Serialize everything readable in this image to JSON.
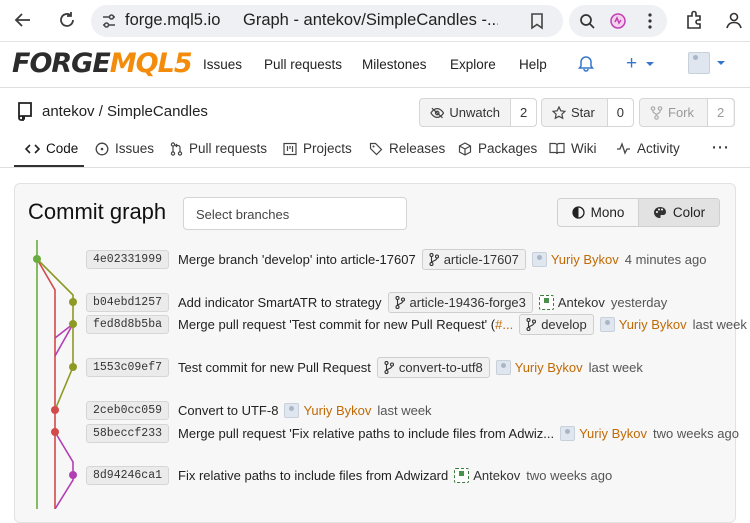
{
  "browser": {
    "host": "forge.mql5.io",
    "tab_title": "Graph - antekov/SimpleCandles -..."
  },
  "brand": {
    "logo_part1": "FORGE",
    "logo_part2": "MQL5",
    "accent": "#f28c0a"
  },
  "topnav": {
    "issues": "Issues",
    "pull_requests": "Pull requests",
    "milestones": "Milestones",
    "explore": "Explore",
    "help": "Help",
    "plus": "+"
  },
  "repo": {
    "full_name": "antekov / SimpleCandles",
    "unwatch_label": "Unwatch",
    "watch_count": "2",
    "star_label": "Star",
    "star_count": "0",
    "fork_label": "Fork",
    "fork_count": "2"
  },
  "tabs": {
    "code": "Code",
    "issues": "Issues",
    "pull_requests": "Pull requests",
    "projects": "Projects",
    "releases": "Releases",
    "packages": "Packages",
    "wiki": "Wiki",
    "activity": "Activity",
    "more": "⋯"
  },
  "graph": {
    "title": "Commit graph",
    "branch_placeholder": "Select branches",
    "mono_label": "Mono",
    "color_label": "Color",
    "colors": {
      "green": "#6aac3f",
      "olive": "#8e9a24",
      "red": "#d24a4a",
      "purple": "#b13fb3"
    }
  },
  "commits": [
    {
      "sha": "4e02331999",
      "message": "Merge branch 'develop' into article-17607",
      "ref": "article-17607",
      "author": "Yuriy Bykov",
      "author_linked": true,
      "time": "4 minutes ago"
    },
    {
      "sha": "b04ebd1257",
      "message": "Add indicator SmartATR to strategy",
      "ref": "article-19436-forge3",
      "author": "Antekov",
      "author_linked": false,
      "time": "yesterday"
    },
    {
      "sha": "fed8d8b5ba",
      "message": "Merge pull request 'Test commit for new Pull Request' (",
      "message_link": "#...",
      "ref": "develop",
      "author": "Yuriy Bykov",
      "author_linked": true,
      "time": "last week"
    },
    {
      "sha": "1553c09ef7",
      "message": "Test commit for new Pull Request",
      "ref": "convert-to-utf8",
      "author": "Yuriy Bykov",
      "author_linked": true,
      "time": "last week"
    },
    {
      "sha": "2ceb0cc059",
      "message": "Convert to UTF-8",
      "ref": "",
      "author": "Yuriy Bykov",
      "author_linked": true,
      "time": "last week"
    },
    {
      "sha": "58beccf233",
      "message": "Merge pull request 'Fix relative paths to include files from Adwiz...",
      "ref": "",
      "author": "Yuriy Bykov",
      "author_linked": true,
      "time": "two weeks ago"
    },
    {
      "sha": "8d94246ca1",
      "message": "Fix relative paths to include files from Adwizard",
      "ref": "",
      "author": "Antekov",
      "author_linked": false,
      "time": "two weeks ago"
    }
  ]
}
